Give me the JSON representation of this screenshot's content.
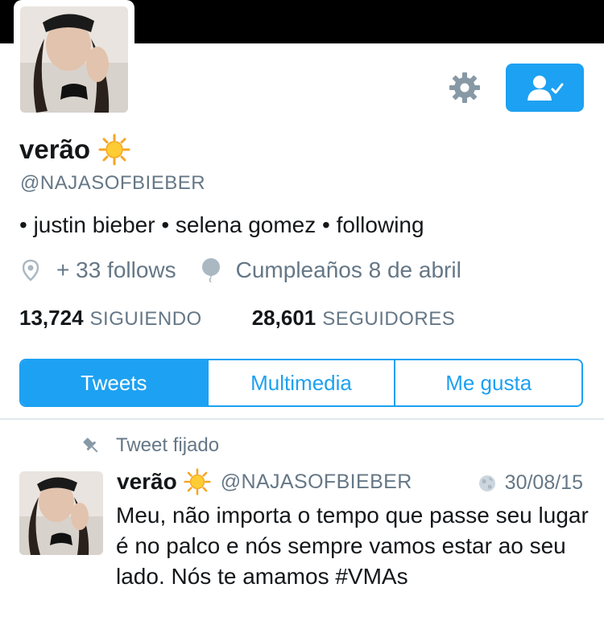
{
  "profile": {
    "display_name": "verão",
    "name_emoji": "sun-emoji",
    "handle": "@NAJASOFBIEBER",
    "bio": "• justin bieber • selena gomez • following",
    "location": "+ 33 follows",
    "birthday": "Cumpleaños 8 de abril"
  },
  "stats": {
    "following_count": "13,724",
    "following_label": "SIGUIENDO",
    "followers_count": "28,601",
    "followers_label": "SEGUIDORES"
  },
  "tabs": [
    {
      "label": "Tweets",
      "active": true
    },
    {
      "label": "Multimedia",
      "active": false
    },
    {
      "label": "Me gusta",
      "active": false
    }
  ],
  "pinned_tweet": {
    "pinned_label": "Tweet fijado",
    "author_name": "verão",
    "author_handle": "@NAJASOFBIEBER",
    "date": "30/08/15",
    "text": "Meu, não importa o tempo que passe seu lugar é no palco e nós sempre vamos estar ao seu lado. Nós te amamos #VMAs"
  },
  "colors": {
    "accent": "#1da1f2",
    "secondary_text": "#657786",
    "banner": "#000000"
  },
  "icons": [
    "gear-icon",
    "following-user-icon",
    "location-pin-icon",
    "balloon-icon",
    "pin-icon",
    "globe-icon",
    "sun-emoji"
  ]
}
